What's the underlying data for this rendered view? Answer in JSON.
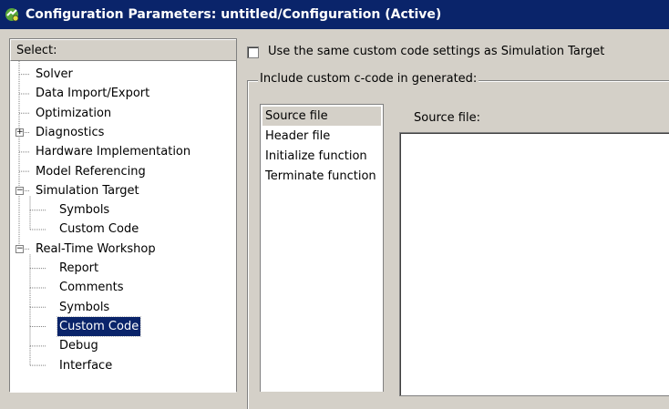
{
  "window": {
    "title": "Configuration Parameters: untitled/Configuration (Active)",
    "icon": "simulink-config-icon"
  },
  "select_panel": {
    "header": "Select:",
    "items": [
      {
        "label": "Solver",
        "level": 0
      },
      {
        "label": "Data Import/Export",
        "level": 0
      },
      {
        "label": "Optimization",
        "level": 0
      },
      {
        "label": "Diagnostics",
        "level": 0,
        "expander": "+"
      },
      {
        "label": "Hardware Implementation",
        "level": 0
      },
      {
        "label": "Model Referencing",
        "level": 0
      },
      {
        "label": "Simulation Target",
        "level": 0,
        "expander": "-"
      },
      {
        "label": "Symbols",
        "level": 1
      },
      {
        "label": "Custom Code",
        "level": 1
      },
      {
        "label": "Real-Time Workshop",
        "level": 0,
        "expander": "-"
      },
      {
        "label": "Report",
        "level": 1
      },
      {
        "label": "Comments",
        "level": 1
      },
      {
        "label": "Symbols",
        "level": 1
      },
      {
        "label": "Custom Code",
        "level": 1,
        "selected": true
      },
      {
        "label": "Debug",
        "level": 1
      },
      {
        "label": "Interface",
        "level": 1
      }
    ]
  },
  "settings": {
    "same_settings_checkbox": {
      "label": "Use the same custom code settings as Simulation Target",
      "checked": false
    },
    "group_title": "Include custom c-code in generated:",
    "file_types": [
      {
        "label": "Source file",
        "active": true
      },
      {
        "label": "Header file"
      },
      {
        "label": "Initialize function"
      },
      {
        "label": "Terminate function"
      }
    ],
    "editor_label": "Source file:",
    "editor_value": ""
  },
  "colors": {
    "titlebar": "#0a246a",
    "selection": "#0a246a",
    "face": "#d4d0c8"
  }
}
